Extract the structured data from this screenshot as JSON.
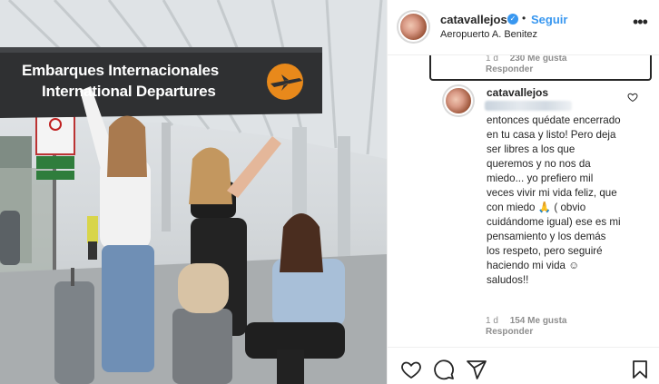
{
  "post": {
    "photo": {
      "sign_line1": "Embarques Internacionales",
      "sign_line2": "International Departures",
      "small_sign1": "CHECK-IN VEHICULOS",
      "small_sign2": "SEGURIDAD Y SALUD EMPLEADOS"
    }
  },
  "header": {
    "username": "catavallejos",
    "verified_icon": "verified-badge-icon",
    "separator": "•",
    "follow_label": "Seguir",
    "location": "Aeropuerto A. Benitez",
    "more_icon": "more-options-icon"
  },
  "comments": {
    "previous": {
      "time": "1 d",
      "likes": "230 Me gusta",
      "reply_label": "Responder"
    },
    "reply": {
      "username": "catavallejos",
      "text": "entonces quédate encerrado en tu casa y listo! Pero deja ser libres a los que queremos y no nos da miedo... yo prefiero mil veces vivir mi vida feliz, que con miedo 🙏 ( obvio cuidándome igual) ese es mi pensamiento y los demás los respeto, pero seguiré haciendo mi vida ☺ saludos!!",
      "time": "1 d",
      "likes": "154 Me gusta",
      "reply_label": "Responder"
    }
  },
  "actions": [
    "like-icon",
    "comment-icon",
    "share-icon",
    "save-icon"
  ],
  "colors": {
    "accent": "#3897f0",
    "text": "#262626",
    "muted": "#8e8e8e",
    "border": "#efefef"
  }
}
